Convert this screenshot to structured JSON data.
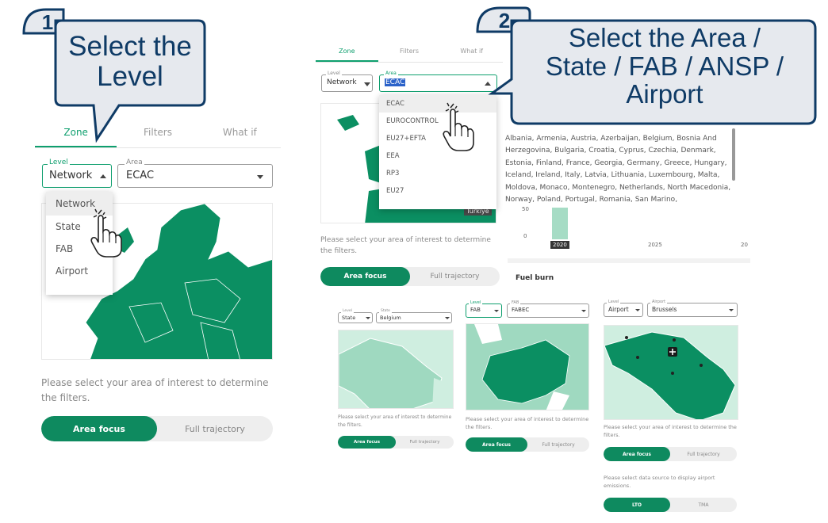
{
  "callouts": {
    "step1": {
      "number": "1",
      "text_line1": "Select the",
      "text_line2": "Level"
    },
    "step2": {
      "number": "2",
      "text_line1": "Select the Area /",
      "text_line2": "State / FAB / ANSP /",
      "text_line3": "Airport"
    }
  },
  "panel_left": {
    "tabs": [
      "Zone",
      "Filters",
      "What if"
    ],
    "level_label": "Level",
    "level_value": "Network",
    "area_label": "Area",
    "area_value": "ECAC",
    "level_options": [
      "Network",
      "State",
      "FAB",
      "Airport"
    ],
    "description": "Please select your area of interest to determine the filters.",
    "toggle": [
      "Area focus",
      "Full trajectory"
    ]
  },
  "panel_top": {
    "tabs": [
      "Zone",
      "Filters",
      "What if"
    ],
    "level_label": "Level",
    "level_value": "Network",
    "area_label": "Area",
    "area_value": "ECAC",
    "area_options": [
      "ECAC",
      "EUROCONTROL",
      "EU27+EFTA",
      "EEA",
      "RP3",
      "EU27"
    ],
    "map_tag": "Türkiye",
    "description": "Please select your area of interest to determine the filters.",
    "toggle": [
      "Area focus",
      "Full trajectory"
    ],
    "states_text": "Albania, Armenia, Austria, Azerbaijan, Belgium, Bosnia And Herzegovina, Bulgaria, Croatia, Cyprus, Czechia, Denmark, Estonia, Finland, France, Georgia, Germany, Greece, Hungary, Iceland, Ireland, Italy, Latvia, Lithuania, Luxembourg, Malta, Moldova, Monaco, Montenegro, Netherlands, North Macedonia, Norway, Poland, Portugal, Romania, San Marino,",
    "chart_y_tick_50": "50",
    "chart_y_tick_0": "0",
    "chart_x_ticks": [
      "2020",
      "2025",
      "20"
    ],
    "fuel_burn_label": "Fuel burn"
  },
  "panel_state": {
    "level_label": "Level",
    "level_value": "State",
    "area_label": "State",
    "area_value": "Belgium",
    "description": "Please select your area of interest to determine the filters.",
    "toggle": [
      "Area focus",
      "Full trajectory"
    ]
  },
  "panel_fab": {
    "level_label": "Level",
    "level_value": "FAB",
    "area_label": "FAB",
    "area_value": "FABEC",
    "description": "Please select your area of interest to determine the filters.",
    "toggle": [
      "Area focus",
      "Full trajectory"
    ]
  },
  "panel_airport": {
    "level_label": "Level",
    "level_value": "Airport",
    "area_label": "Airport",
    "area_value": "Brussels",
    "description": "Please select your area of interest to determine the filters.",
    "toggle": [
      "Area focus",
      "Full trajectory"
    ],
    "source_description": "Please select data source to display airport emissions.",
    "source_toggle": [
      "LTO",
      "TMA"
    ]
  },
  "colors": {
    "accent_green": "#0e8a5f",
    "map_green": "#0b8f62",
    "map_light": "#9fd9c0",
    "callout_fill": "#e6e9ee",
    "callout_stroke": "#0f3b66"
  }
}
